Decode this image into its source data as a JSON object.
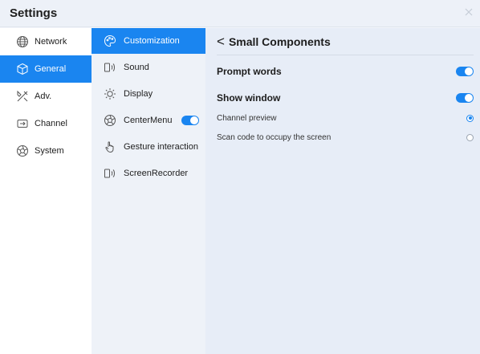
{
  "window": {
    "title": "Settings"
  },
  "nav_primary": [
    {
      "label": "Network",
      "icon": "globe-icon",
      "active": false
    },
    {
      "label": "General",
      "icon": "cube-icon",
      "active": true
    },
    {
      "label": "Adv.",
      "icon": "tools-icon",
      "active": false
    },
    {
      "label": "Channel",
      "icon": "channel-icon",
      "active": false
    },
    {
      "label": "System",
      "icon": "aperture-icon",
      "active": false
    }
  ],
  "nav_secondary": [
    {
      "label": "Customization",
      "icon": "palette-icon",
      "active": true
    },
    {
      "label": "Sound",
      "icon": "speaker-icon",
      "active": false
    },
    {
      "label": "Display",
      "icon": "brightness-icon",
      "active": false
    },
    {
      "label": "CenterMenu",
      "icon": "aperture-icon",
      "active": false,
      "toggle_on": true
    },
    {
      "label": "Gesture interaction",
      "icon": "hand-icon",
      "active": false
    },
    {
      "label": "ScreenRecorder",
      "icon": "speaker-icon",
      "active": false
    }
  ],
  "main": {
    "header": {
      "back_icon": "chevron-left-icon",
      "back_glyph": "<",
      "title": "Small Components"
    },
    "settings": [
      {
        "label": "Prompt words",
        "toggle_on": true
      },
      {
        "label": "Show window",
        "toggle_on": true
      }
    ],
    "options": [
      {
        "label": "Channel preview",
        "selected": true
      },
      {
        "label": "Scan code to occupy the screen",
        "selected": false
      }
    ]
  },
  "colors": {
    "accent": "#1a85f0",
    "panel": "#e7edf7"
  }
}
